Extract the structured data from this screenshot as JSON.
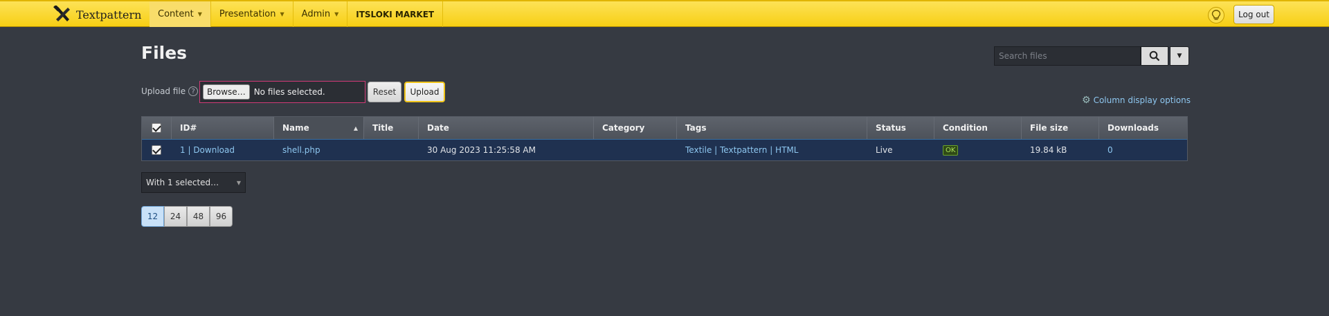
{
  "app": {
    "name": "Textpattern"
  },
  "nav": {
    "items": [
      {
        "label": "Content"
      },
      {
        "label": "Presentation"
      },
      {
        "label": "Admin"
      }
    ],
    "site_name": "ITSLOKI MARKET",
    "logout_label": "Log out"
  },
  "page": {
    "title": "Files",
    "search_placeholder": "Search files"
  },
  "upload": {
    "label": "Upload file",
    "help": "?",
    "browse_label": "Browse…",
    "file_status": "No files selected.",
    "reset_label": "Reset",
    "upload_label": "Upload"
  },
  "column_options_label": "Column display options",
  "table": {
    "headers": [
      "ID#",
      "Name",
      "Title",
      "Date",
      "Category",
      "Tags",
      "Status",
      "Condition",
      "File size",
      "Downloads"
    ],
    "sorted_column": "Name",
    "rows": [
      {
        "checked": true,
        "id": "1",
        "id_sep": " | ",
        "download": "Download",
        "name": "shell.php",
        "title": "",
        "date": "30 Aug 2023 11:25:58 AM",
        "category": "",
        "tags": [
          "Textile",
          "Textpattern",
          "HTML"
        ],
        "tag_sep": " | ",
        "status": "Live",
        "condition": "OK",
        "file_size": "19.84 kB",
        "downloads": "0"
      }
    ]
  },
  "bulk": {
    "label": "With 1 selected…"
  },
  "pagination": {
    "options": [
      "12",
      "24",
      "48",
      "96"
    ],
    "selected": "12"
  },
  "colors": {
    "topbar": "#f7cf14",
    "background": "#363a42",
    "link": "#8ec7f0",
    "row_selected": "#1f3150",
    "ok_badge": "#a8e05a"
  }
}
